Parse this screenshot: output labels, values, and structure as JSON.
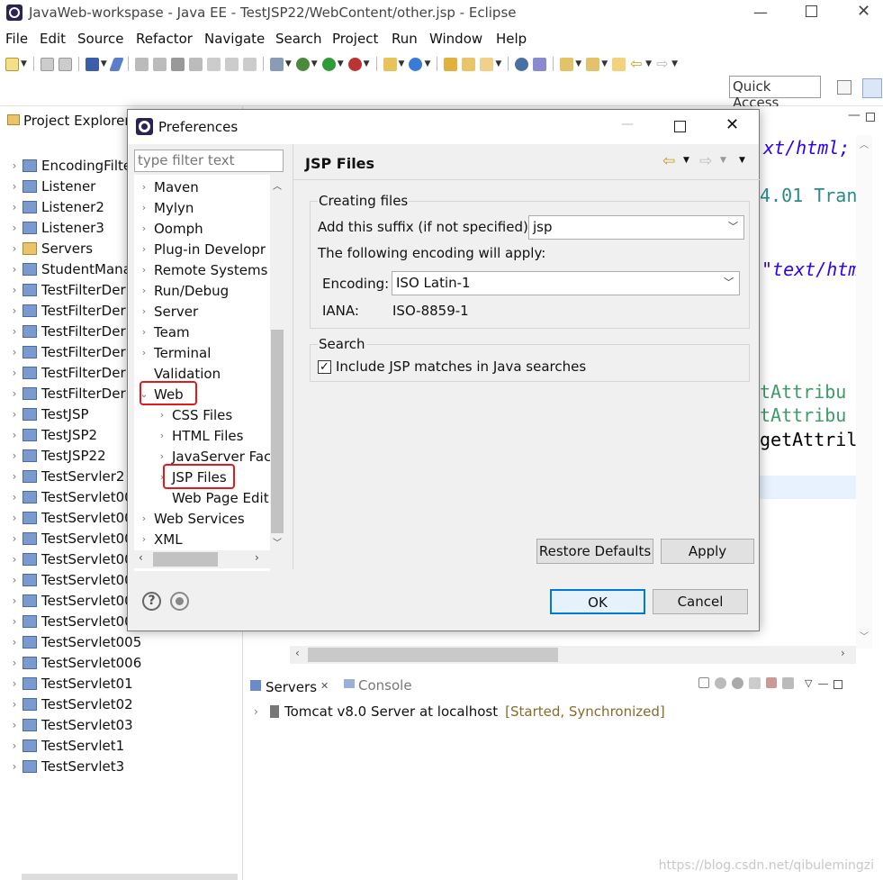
{
  "window": {
    "title": "JavaWeb-workspase - Java EE - TestJSP22/WebContent/other.jsp - Eclipse"
  },
  "menu": [
    "File",
    "Edit",
    "Source",
    "Refactor",
    "Navigate",
    "Search",
    "Project",
    "Run",
    "Window",
    "Help"
  ],
  "quick_access": "Quick Access",
  "project_explorer": {
    "title": "Project Explorer",
    "items": [
      "EncodingFilte",
      "Listener",
      "Listener2",
      "Listener3",
      "Servers",
      "StudentMana",
      "TestFilterDer",
      "TestFilterDer",
      "TestFilterDer",
      "TestFilterDer",
      "TestFilterDer",
      "TestFilterDer",
      "TestJSP",
      "TestJSP2",
      "TestJSP22",
      "TestServler2",
      "TestServlet00",
      "TestServlet00",
      "TestServlet00",
      "TestServlet00",
      "TestServlet00",
      "TestServlet00",
      "TestServlet00",
      "TestServlet005",
      "TestServlet006",
      "TestServlet01",
      "TestServlet02",
      "TestServlet03",
      "TestServlet1",
      "TestServlet3"
    ]
  },
  "editor": {
    "lines": [
      "xt/html;",
      "4.01 Tran",
      "\"text/htm",
      "tAttribu",
      "tAttribu",
      "getAttril"
    ]
  },
  "servers_view": {
    "tabs": [
      "Servers",
      "Console"
    ],
    "server": "Tomcat v8.0 Server at localhost",
    "status": "[Started, Synchronized]"
  },
  "watermark": "https://blog.csdn.net/qibulemingzi",
  "dialog": {
    "title": "Preferences",
    "filter_placeholder": "type filter text",
    "tree": [
      {
        "label": "Maven",
        "expanded": false
      },
      {
        "label": "Mylyn",
        "expanded": false
      },
      {
        "label": "Oomph",
        "expanded": false
      },
      {
        "label": "Plug-in Developr",
        "expanded": false
      },
      {
        "label": "Remote Systems",
        "expanded": false
      },
      {
        "label": "Run/Debug",
        "expanded": false
      },
      {
        "label": "Server",
        "expanded": false
      },
      {
        "label": "Team",
        "expanded": false
      },
      {
        "label": "Terminal",
        "expanded": false
      },
      {
        "label": "Validation",
        "expanded": null
      },
      {
        "label": "Web",
        "expanded": true
      },
      {
        "label": "CSS Files",
        "expanded": false
      },
      {
        "label": "HTML Files",
        "expanded": false
      },
      {
        "label": "JavaServer Fac",
        "expanded": false
      },
      {
        "label": "JSP Files",
        "expanded": false
      },
      {
        "label": "Web Page Edit",
        "expanded": null
      },
      {
        "label": "Web Services",
        "expanded": false
      },
      {
        "label": "XML",
        "expanded": false
      }
    ],
    "page_title": "JSP Files",
    "creating_files": {
      "group": "Creating files",
      "suffix_label": "Add this suffix (if not specified):",
      "suffix_value": "jsp",
      "encoding_note": "The following encoding will apply:",
      "encoding_label": "Encoding:",
      "encoding_value": "ISO Latin-1",
      "iana_label": "IANA:",
      "iana_value": "ISO-8859-1"
    },
    "search": {
      "group": "Search",
      "checkbox_label": "Include JSP matches in Java searches",
      "checked": true
    },
    "buttons": {
      "restore": "Restore Defaults",
      "apply": "Apply",
      "ok": "OK",
      "cancel": "Cancel"
    }
  }
}
